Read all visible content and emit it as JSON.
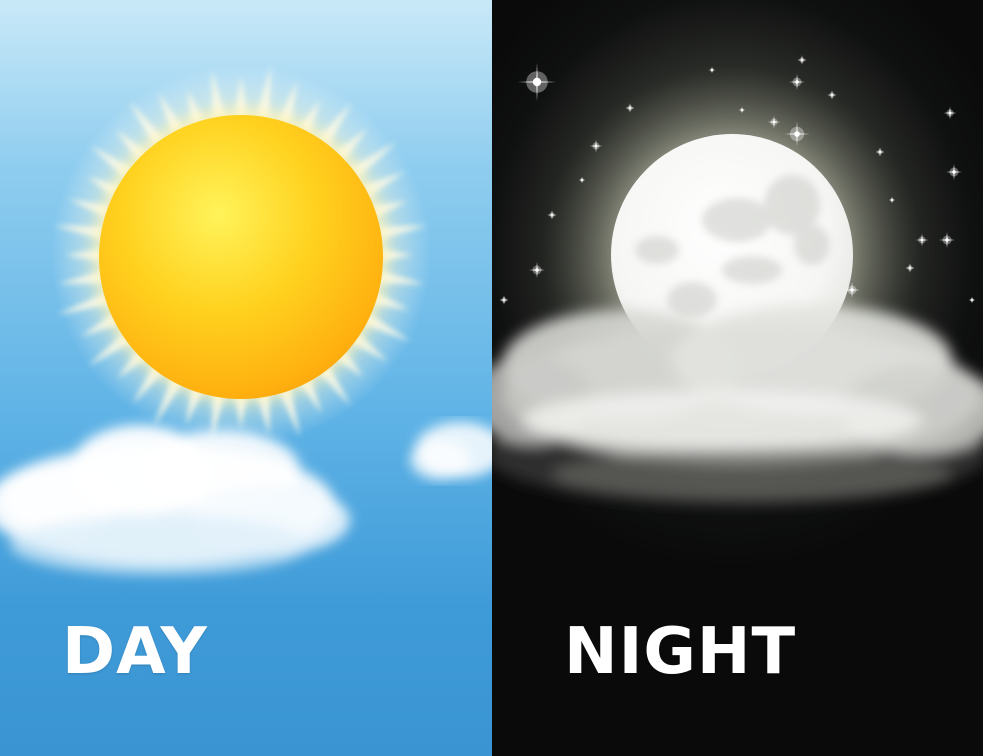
{
  "day": {
    "label": "DAY"
  },
  "night": {
    "label": "NIGHT"
  }
}
